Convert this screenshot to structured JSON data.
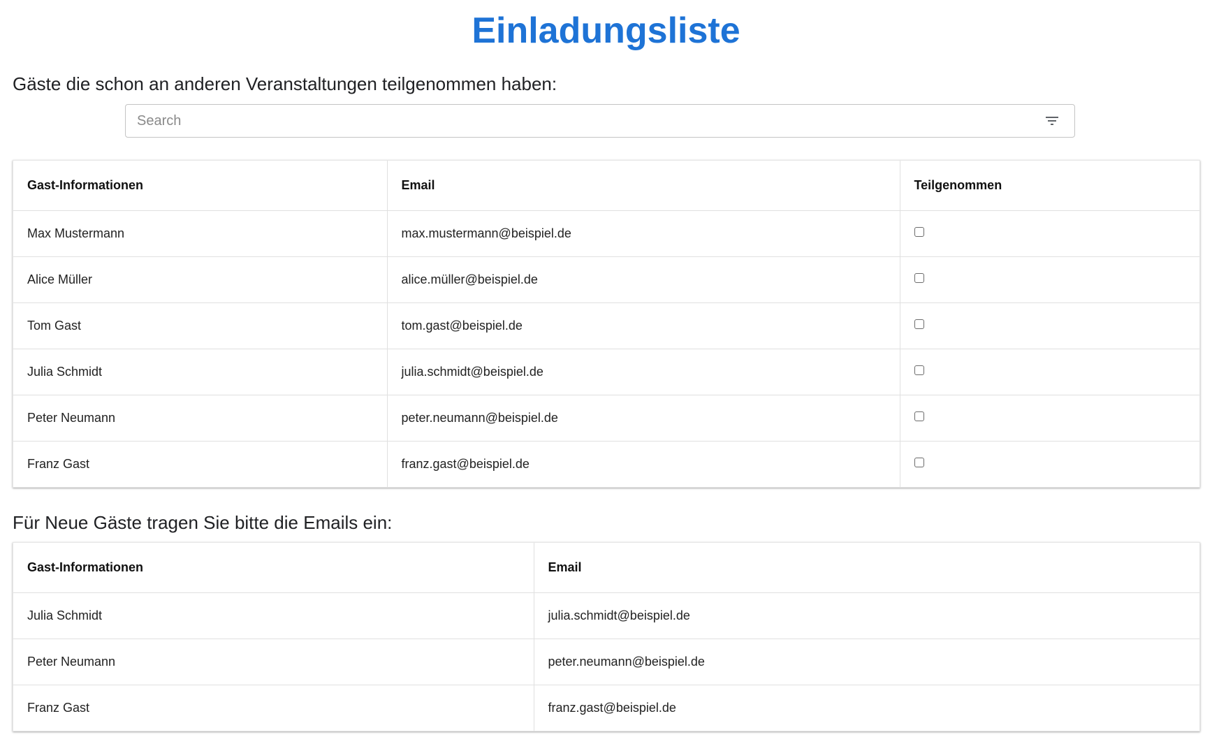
{
  "page": {
    "title": "Einladungsliste",
    "title_color": "#1e73d6"
  },
  "previous_guests": {
    "label": "Gäste die schon an anderen Veranstaltungen teilgenommen haben:",
    "search": {
      "placeholder": "Search",
      "value": "",
      "filter_icon": "filter-list-icon"
    },
    "columns": [
      "Gast-Informationen",
      "Email",
      "Teilgenommen"
    ],
    "rows": [
      {
        "name": "Max Mustermann",
        "email": "max.mustermann@beispiel.de",
        "attended": false
      },
      {
        "name": "Alice Müller",
        "email": "alice.müller@beispiel.de",
        "attended": false
      },
      {
        "name": "Tom Gast",
        "email": "tom.gast@beispiel.de",
        "attended": false
      },
      {
        "name": "Julia Schmidt",
        "email": "julia.schmidt@beispiel.de",
        "attended": false
      },
      {
        "name": "Peter Neumann",
        "email": "peter.neumann@beispiel.de",
        "attended": false
      },
      {
        "name": "Franz Gast",
        "email": "franz.gast@beispiel.de",
        "attended": false
      }
    ]
  },
  "new_guests": {
    "label": "Für Neue Gäste tragen Sie bitte die Emails ein:",
    "columns": [
      "Gast-Informationen",
      "Email"
    ],
    "rows": [
      {
        "name": "Julia Schmidt",
        "email": "julia.schmidt@beispiel.de"
      },
      {
        "name": "Peter Neumann",
        "email": "peter.neumann@beispiel.de"
      },
      {
        "name": "Franz Gast",
        "email": "franz.gast@beispiel.de"
      }
    ]
  }
}
